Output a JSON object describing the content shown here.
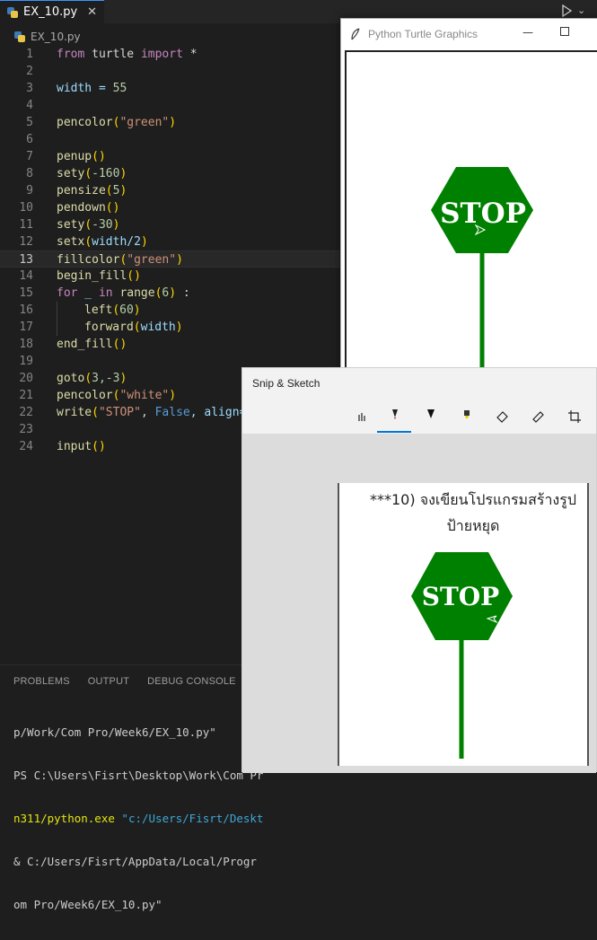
{
  "editor": {
    "tab_label": "EX_10.py",
    "tab_close": "✕",
    "breadcrumb": "EX_10.py",
    "lines": [
      {
        "n": "1"
      },
      {
        "n": "2"
      },
      {
        "n": "3"
      },
      {
        "n": "4"
      },
      {
        "n": "5"
      },
      {
        "n": "6"
      },
      {
        "n": "7"
      },
      {
        "n": "8"
      },
      {
        "n": "9"
      },
      {
        "n": "10"
      },
      {
        "n": "11"
      },
      {
        "n": "12"
      },
      {
        "n": "13"
      },
      {
        "n": "14"
      },
      {
        "n": "15"
      },
      {
        "n": "16"
      },
      {
        "n": "17"
      },
      {
        "n": "18"
      },
      {
        "n": "19"
      },
      {
        "n": "20"
      },
      {
        "n": "21"
      },
      {
        "n": "22"
      },
      {
        "n": "23"
      },
      {
        "n": "24"
      }
    ],
    "code": {
      "l1": {
        "from": "from",
        "mod": " turtle ",
        "imp": "import",
        "rest": " *"
      },
      "l3": {
        "a": "width = ",
        "b": "55"
      },
      "l5": {
        "fn": "pencolor",
        "p1": "(",
        "s": "\"green\"",
        "p2": ")"
      },
      "l7": {
        "fn": "penup",
        "p": "()"
      },
      "l8": {
        "fn": "sety",
        "p1": "(",
        "v": "-160",
        "p2": ")"
      },
      "l9": {
        "fn": "pensize",
        "p1": "(",
        "v": "5",
        "p2": ")"
      },
      "l10": {
        "fn": "pendown",
        "p": "()"
      },
      "l11": {
        "fn": "sety",
        "p1": "(",
        "v": "-30",
        "p2": ")"
      },
      "l12": {
        "fn": "setx",
        "p1": "(",
        "v": "width/2",
        "p2": ")"
      },
      "l13": {
        "fn": "fillcolor",
        "p1": "(",
        "s": "\"green\"",
        "p2": ")"
      },
      "l14": {
        "fn": "begin_fill",
        "p": "()"
      },
      "l15": {
        "kw": "for",
        "a": " _ ",
        "in": "in",
        "fn": " range",
        "p1": "(",
        "v": "6",
        "p2": ")",
        "b": " :"
      },
      "l16": {
        "fn": "left",
        "p1": "(",
        "v": "60",
        "p2": ")"
      },
      "l17": {
        "fn": "forward",
        "p1": "(",
        "v": "width",
        "p2": ")"
      },
      "l18": {
        "fn": "end_fill",
        "p": "()"
      },
      "l20": {
        "fn": "goto",
        "p1": "(",
        "v": "3,-3",
        "p2": ")"
      },
      "l21": {
        "fn": "pencolor",
        "p1": "(",
        "s": "\"white\"",
        "p2": ")"
      },
      "l22": {
        "fn": "write",
        "p1": "(",
        "s": "\"STOP\"",
        "c": ", ",
        "k": "False",
        "r": ", align="
      },
      "l24": {
        "fn": "input",
        "p": "()"
      }
    }
  },
  "panel": {
    "tabs": [
      "PROBLEMS",
      "OUTPUT",
      "DEBUG CONSOLE"
    ],
    "terminal": {
      "t1": "p/Work/Com Pro/Week6/EX_10.py\"",
      "t2": "PS C:\\Users\\Fisrt\\Desktop\\Work\\Com Pr",
      "t3a": "n311/python.exe",
      "t3b": " \"c:/Users/Fisrt/Deskt",
      "t4": "& C:/Users/Fisrt/AppData/Local/Progr",
      "t5": "om Pro/Week6/EX_10.py\""
    }
  },
  "turtle_window": {
    "title": "Python Turtle Graphics",
    "minimize": "—",
    "sign_text": "STOP",
    "sign_color": "#008000",
    "scroll_left": "<"
  },
  "snip_sketch": {
    "title": "Snip & Sketch",
    "question_line1": "***10) จงเขียนโปรแกรมสร้างรูป",
    "question_line2": "ป้ายหยุด",
    "sign_text": "STOP",
    "sign_color": "#008000"
  },
  "colors": {
    "accent": "#0078d7",
    "editor_bg": "#1e1e1e"
  }
}
